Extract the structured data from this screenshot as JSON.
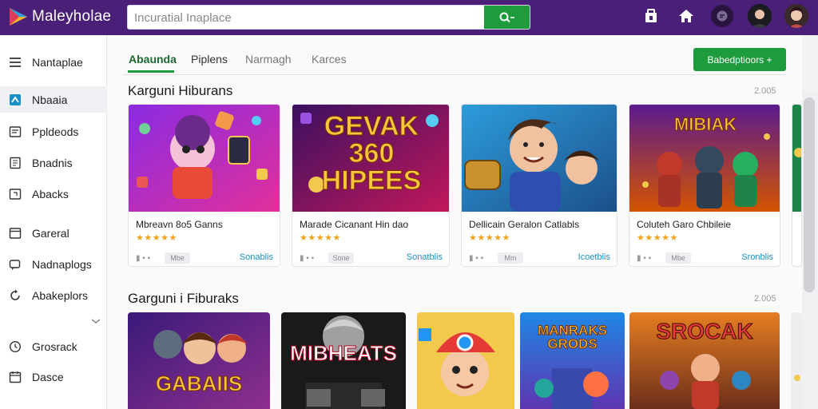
{
  "app": {
    "brand": "Maleyholae",
    "colors": {
      "topbar": "#4a1f78",
      "accent": "#1e9b3c",
      "link": "#1a8fc4",
      "stars": "#f2a31b"
    }
  },
  "search": {
    "placeholder": "Incuratial Inaplace",
    "button_icon": "search-icon"
  },
  "topbar_icons": [
    "store-icon",
    "home-icon",
    "message-icon",
    "avatar",
    "avatar"
  ],
  "sidebar": {
    "items": [
      {
        "label": "Nantaplae",
        "icon": "menu-icon"
      },
      {
        "label": "Nbaaia",
        "icon": "app-icon"
      },
      {
        "label": "Ppldeods",
        "icon": "list-icon"
      },
      {
        "label": "Bnadnis",
        "icon": "document-icon"
      },
      {
        "label": "Abacks",
        "icon": "image-icon"
      },
      {
        "label": "Gareral",
        "icon": "window-icon"
      },
      {
        "label": "Nadnaplogs",
        "icon": "chat-icon"
      },
      {
        "label": "Abakeplors",
        "icon": "refresh-icon"
      },
      {
        "label": "Grosrack",
        "icon": "clock-icon"
      },
      {
        "label": "Dasce",
        "icon": "calendar-icon"
      }
    ]
  },
  "tabs": [
    {
      "label": "Abaunda"
    },
    {
      "label": "Piplens"
    },
    {
      "label": "Narmagh"
    },
    {
      "label": "Karces"
    }
  ],
  "cta_label": "Babedptioors +",
  "sections": [
    {
      "title": "Karguni Hiburans",
      "count": "2.005",
      "cards": [
        {
          "title": "Mbreavn 8o5 Ganns",
          "stars": "★★★★★",
          "chip": "Mbe",
          "link": "Sonablis",
          "thumb_text": ""
        },
        {
          "title": "Marade Cicanant Hin dao",
          "stars": "★★★★★",
          "chip": "Sone",
          "link": "Sonatblis",
          "thumb_text": "GEVAK 360 HIPEES"
        },
        {
          "title": "Dellicain Geralon Catlabls",
          "stars": "★★★★★",
          "chip": "Mm",
          "link": "Icoetblis",
          "thumb_text": ""
        },
        {
          "title": "Coluteh Garo Chbileie",
          "stars": "★★★★★",
          "chip": "Mbe",
          "link": "Sronblis",
          "thumb_text": "MIBIAK"
        }
      ]
    },
    {
      "title": "Garguni i Fiburaks",
      "count": "2.005",
      "tiles": [
        {
          "thumb_text": "GABAIIS"
        },
        {
          "thumb_text": "MIBHEATS"
        },
        {
          "thumb_text": ""
        },
        {
          "thumb_text": "MANRAKS GRODS"
        },
        {
          "thumb_text": "SROCAK"
        }
      ]
    }
  ]
}
